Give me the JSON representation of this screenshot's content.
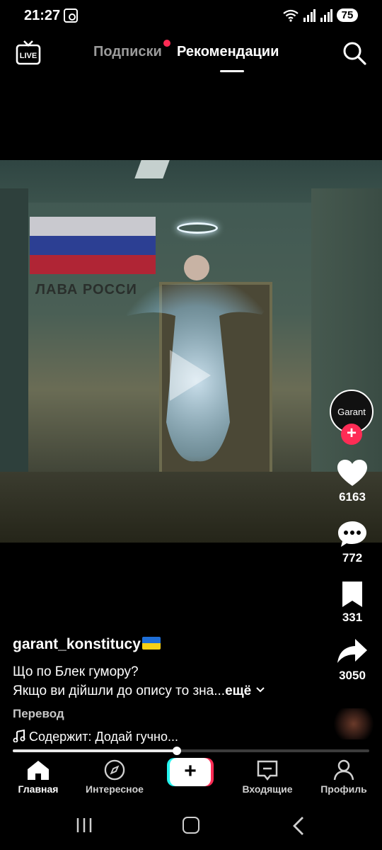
{
  "status_bar": {
    "time": "21:27",
    "battery": "75",
    "icons": [
      "screen-record-icon",
      "wifi-icon",
      "signal-icon",
      "signal-icon",
      "battery-icon"
    ]
  },
  "top_nav": {
    "tabs": [
      {
        "label": "Подписки",
        "active": false,
        "has_notification_dot": true
      },
      {
        "label": "Рекомендации",
        "active": true
      }
    ],
    "live_label": "LIVE"
  },
  "video": {
    "sign_text": "ЛАВА РОССИ",
    "state": "paused"
  },
  "creator": {
    "avatar_text": "Garant",
    "username": "garant_konstitucy"
  },
  "actions": {
    "likes": "6163",
    "comments": "772",
    "saves": "331",
    "shares": "3050"
  },
  "caption": {
    "line1": "Що по Блек гумору?",
    "line2": "Якщо ви дійшли до опису то зна...",
    "more": "ещё",
    "translate": "Перевод",
    "music": "Содержит: Додай гучно..."
  },
  "progress": {
    "fraction": 0.46
  },
  "bottom_nav": {
    "items": [
      {
        "label": "Главная",
        "icon": "home-icon",
        "active": true
      },
      {
        "label": "Интересное",
        "icon": "compass-icon",
        "active": false
      },
      {
        "label": "",
        "icon": "plus-icon",
        "active": false
      },
      {
        "label": "Входящие",
        "icon": "inbox-icon",
        "active": false
      },
      {
        "label": "Профиль",
        "icon": "profile-icon",
        "active": false
      }
    ]
  },
  "colors": {
    "accent": "#fe2c55",
    "cyan": "#25f4ee",
    "background": "#000000"
  }
}
